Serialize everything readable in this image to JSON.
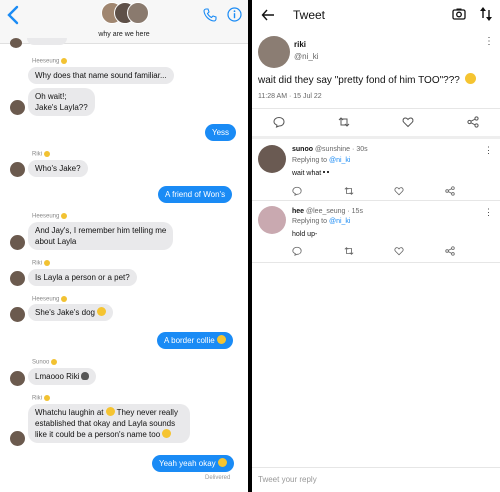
{
  "left": {
    "group_name": "why are we here",
    "messages": [
      {
        "sender": "Heeseung",
        "text": "Why does that name sound familiar..."
      },
      {
        "text_line1": "Oh wait!;",
        "text_line2": "Jake's Layla??"
      },
      {
        "out": "Yess"
      },
      {
        "sender": "Riki",
        "text": "Who's Jake?"
      },
      {
        "out": "A friend of Won's"
      },
      {
        "sender": "Heeseung",
        "line1": "And Jay's, I remember him telling me",
        "line2": "about Layla"
      },
      {
        "sender": "Riki",
        "text": "Is Layla a person or a pet?"
      },
      {
        "sender": "Heeseung",
        "text": "She's Jake's dog"
      },
      {
        "out": "A border collie"
      },
      {
        "sender": "Sunoo",
        "text": "Lmaooo Riki"
      },
      {
        "sender": "Riki",
        "line1": "Whatchu laughin at",
        "line1b": "They never really",
        "line2": "established that okay and Layla sounds",
        "line3": "like it could be a person's name too"
      },
      {
        "out": "Yeah yeah okay"
      }
    ],
    "delivered": "Delivered"
  },
  "right": {
    "title": "Tweet",
    "author": "riki",
    "handle": "@ni_ki",
    "tweet_text": "wait did they say \"pretty fond of him TOO\"???",
    "timestamp": "11:28 AM · 15 Jul 22",
    "replies": [
      {
        "name": "sunoo",
        "handle": "@sunshine",
        "age": "· 30s",
        "replying_prefix": "Replying to",
        "replying_to": "@ni_ki",
        "text": "wait what"
      },
      {
        "name": "hee",
        "handle": "@lee_seung",
        "age": "· 15s",
        "replying_prefix": "Replying to",
        "replying_to": "@ni_ki",
        "text": "hold up-"
      }
    ],
    "reply_placeholder": "Tweet your reply"
  },
  "colors": {
    "imessage_blue": "#1a8bf5",
    "gray_bubble": "#e9e9eb",
    "link_blue": "#1a8bf5"
  }
}
